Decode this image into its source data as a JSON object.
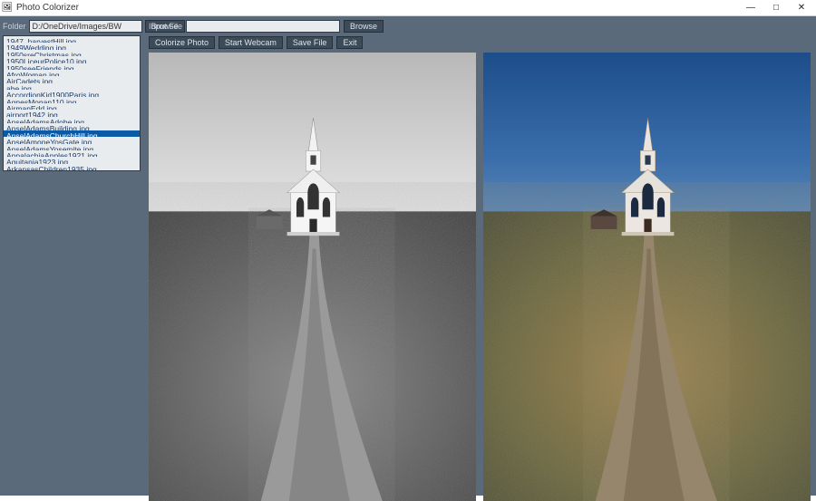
{
  "window": {
    "title": "Photo Colorizer",
    "min": "—",
    "max": "□",
    "close": "✕"
  },
  "sidebar": {
    "folder_label": "Folder",
    "folder_value": "D:/OneDrive/Images/BW",
    "browse": "Browse",
    "files": [
      "1947_harvestHill.jpg",
      "1949Wedding.jpg",
      "1950sreChristmas.jpg",
      "1950LiceurPolice10.jpg",
      "1950seeFriends.jpg",
      "AfroWoman.jpg",
      "AirCadets.jpg",
      "abe.jpg",
      "AccordionKid1900Paris.jpg",
      "AgnesMonan110.jpg",
      "AirmanEdd.jpg",
      "airport1942.jpg",
      "AnselAdamsAdobe.jpg",
      "AnselAdamsBuilding.jpg",
      "AnselAdamsChurchHill.jpg",
      "AnselAmoneYosGate.jpg",
      "AnselAdamsYosemite.jpg",
      "AppalachiaApples1921.jpg",
      "Aquitania1923.jpg",
      "ArkansasChildren1935.jpg"
    ],
    "selected_index": 14
  },
  "toolbar": {
    "input_label": "Input File",
    "input_value": "",
    "browse": "Browse",
    "colorize": "Colorize Photo",
    "webcam": "Start Webcam",
    "save": "Save File",
    "exit": "Exit"
  },
  "icons": {
    "app": "🖼"
  }
}
